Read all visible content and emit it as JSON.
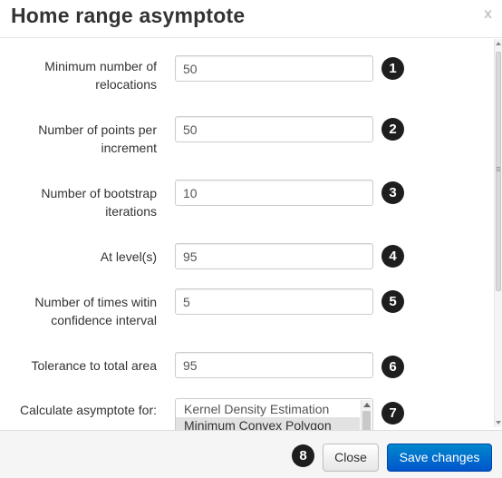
{
  "header": {
    "title": "Home range asymptote",
    "close_label": "x"
  },
  "fields": [
    {
      "label": "Minimum number of relocations",
      "value": "50",
      "step": "1"
    },
    {
      "label": "Number of points per increment",
      "value": "50",
      "step": "2"
    },
    {
      "label": "Number of bootstrap iterations",
      "value": "10",
      "step": "3"
    },
    {
      "label": "At level(s)",
      "value": "95",
      "step": "4"
    },
    {
      "label": "Number of times witin confidence interval",
      "value": "5",
      "step": "5"
    },
    {
      "label": "Tolerance to total area",
      "value": "95",
      "step": "6"
    }
  ],
  "asymptote": {
    "label": "Calculate asymptote for:",
    "options": [
      "Kernel Density Estimation",
      "Minimum Convex Polygon"
    ],
    "selected": "Minimum Convex Polygon",
    "step": "7"
  },
  "footer": {
    "close_label": "Close",
    "save_label": "Save changes",
    "step": "8"
  },
  "colors": {
    "primary": "#0066cc",
    "badge": "#1e1e1e"
  }
}
